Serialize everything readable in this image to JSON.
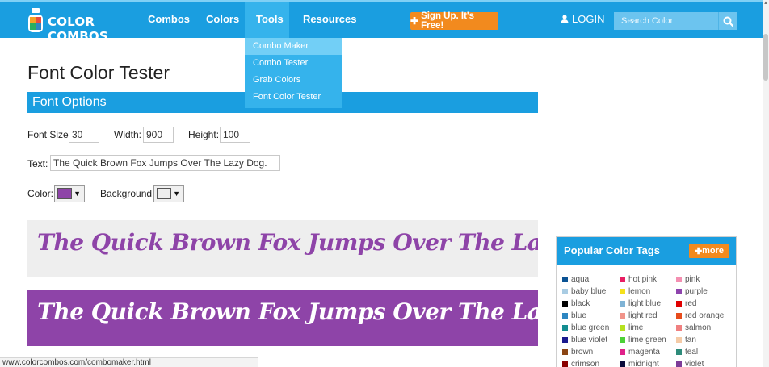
{
  "header": {
    "logo_text": "COLOR COMBOS",
    "nav": [
      "Combos",
      "Colors",
      "Tools",
      "Resources"
    ],
    "signup_label": "Sign Up. It's Free!",
    "login_label": "LOGIN",
    "search_placeholder": "Search Color",
    "brand_color": "#1a9ee0",
    "accent_color": "#f28a1e"
  },
  "tools_menu": {
    "items": [
      "Combo Maker",
      "Combo Tester",
      "Grab Colors",
      "Font Color Tester"
    ],
    "highlighted": "Combo Maker"
  },
  "page": {
    "title": "Font Color Tester",
    "section_title": "Font Options"
  },
  "form": {
    "font_size_label": "Font Size:",
    "font_size_value": "30",
    "width_label": "Width:",
    "width_value": "900",
    "height_label": "Height:",
    "height_value": "100",
    "text_label": "Text:",
    "text_value": "The Quick Brown Fox Jumps Over The Lazy Dog.",
    "color_label": "Color:",
    "color_value": "#8e44a8",
    "background_label": "Background:",
    "background_value": "#eeeeee"
  },
  "previews": [
    {
      "text": "The Quick Brown Fox  Jumps Over The Lazy Dog.",
      "text_color": "#8e44a8",
      "bg_color": "#eeeeee"
    },
    {
      "text": "The Quick Brown Fox  Jumps Over The Lazy Dog.",
      "text_color": "#ffffff",
      "bg_color": "#8e44a8"
    }
  ],
  "popular_tags": {
    "title": "Popular Color Tags",
    "more_label": "more",
    "columns": [
      [
        {
          "name": "aqua",
          "color": "#0b5394"
        },
        {
          "name": "baby blue",
          "color": "#a9cce3"
        },
        {
          "name": "black",
          "color": "#000000"
        },
        {
          "name": "blue",
          "color": "#2e86c1"
        },
        {
          "name": "blue green",
          "color": "#138d90"
        },
        {
          "name": "blue violet",
          "color": "#1a1a8e"
        },
        {
          "name": "brown",
          "color": "#8b4513"
        },
        {
          "name": "crimson",
          "color": "#8b0000"
        }
      ],
      [
        {
          "name": "hot pink",
          "color": "#e91e63"
        },
        {
          "name": "lemon",
          "color": "#f5e11b"
        },
        {
          "name": "light blue",
          "color": "#7fb3d5"
        },
        {
          "name": "light red",
          "color": "#f1948a"
        },
        {
          "name": "lime",
          "color": "#b6e21f"
        },
        {
          "name": "lime green",
          "color": "#4cd137"
        },
        {
          "name": "magenta",
          "color": "#e0218a"
        },
        {
          "name": "midnight",
          "color": "#0b0b3b"
        }
      ],
      [
        {
          "name": "pink",
          "color": "#f48fb1"
        },
        {
          "name": "purple",
          "color": "#8e44ad"
        },
        {
          "name": "red",
          "color": "#e00000"
        },
        {
          "name": "red orange",
          "color": "#e74c1c"
        },
        {
          "name": "salmon",
          "color": "#f08080"
        },
        {
          "name": "tan",
          "color": "#f5cba7"
        },
        {
          "name": "teal",
          "color": "#2e8b7a"
        },
        {
          "name": "violet",
          "color": "#7d3c98"
        }
      ]
    ]
  },
  "status_bar": {
    "url": "www.colorcombos.com/combomaker.html"
  }
}
